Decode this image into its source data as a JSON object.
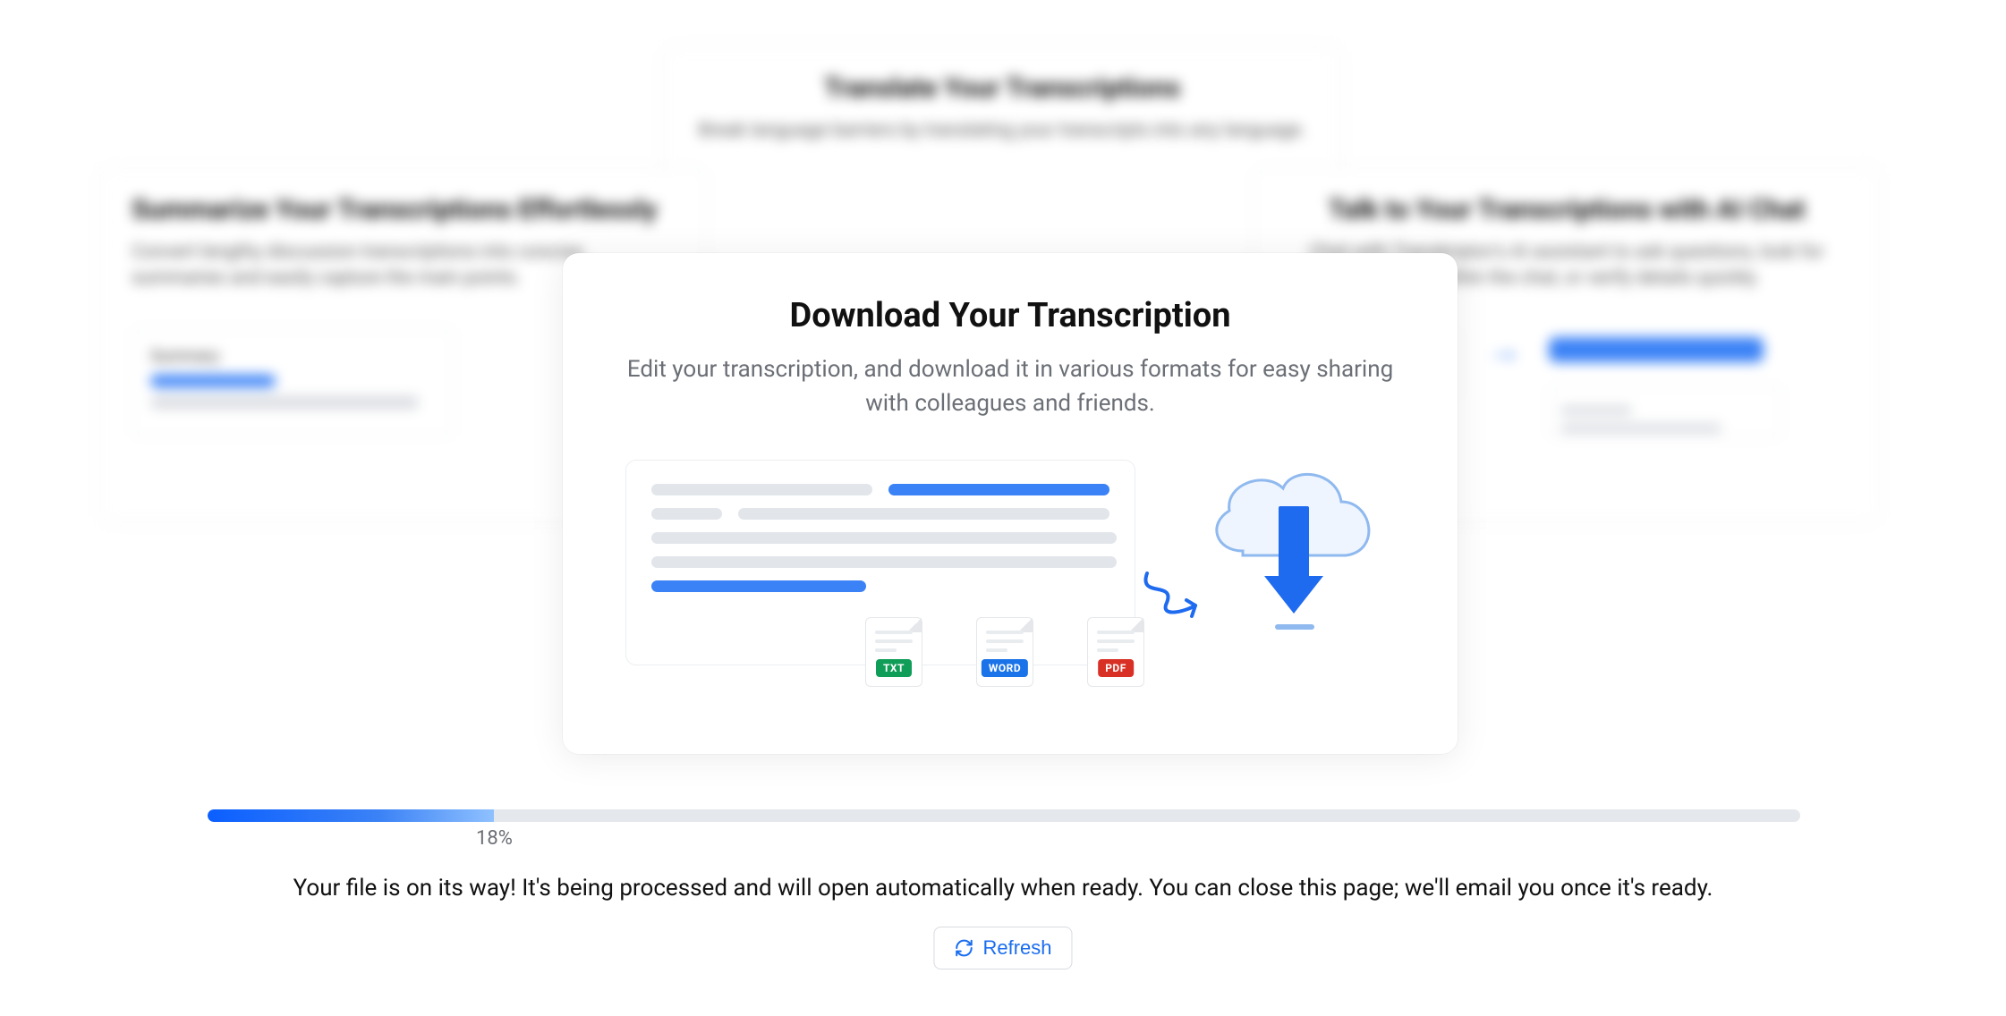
{
  "background_cards": {
    "top": {
      "title": "Translate Your Transcriptions",
      "subtitle": "Break language barriers by translating your transcripts into any language."
    },
    "left": {
      "title": "Summarize Your Transcriptions Effortlessly",
      "subtitle": "Convert lengthy discussion transcriptions into concise summaries and easily capture the main points."
    },
    "right": {
      "title": "Talk to Your Transcriptions with AI Chat",
      "subtitle": "Chat with Transkriptor's AI assistant to ask questions, look for details within the chat, or verify details quickly."
    }
  },
  "main_card": {
    "title": "Download Your Transcription",
    "subtitle": "Edit your transcription, and download it in various formats for easy sharing with colleagues and friends.",
    "formats": {
      "txt": "TXT",
      "word": "WORD",
      "pdf": "PDF"
    }
  },
  "progress": {
    "percent": 18,
    "label": "18%"
  },
  "status_text": "Your file is on its way! It's being processed and will open automatically when ready. You can close this page; we'll email you once it's ready.",
  "refresh_button": "Refresh"
}
